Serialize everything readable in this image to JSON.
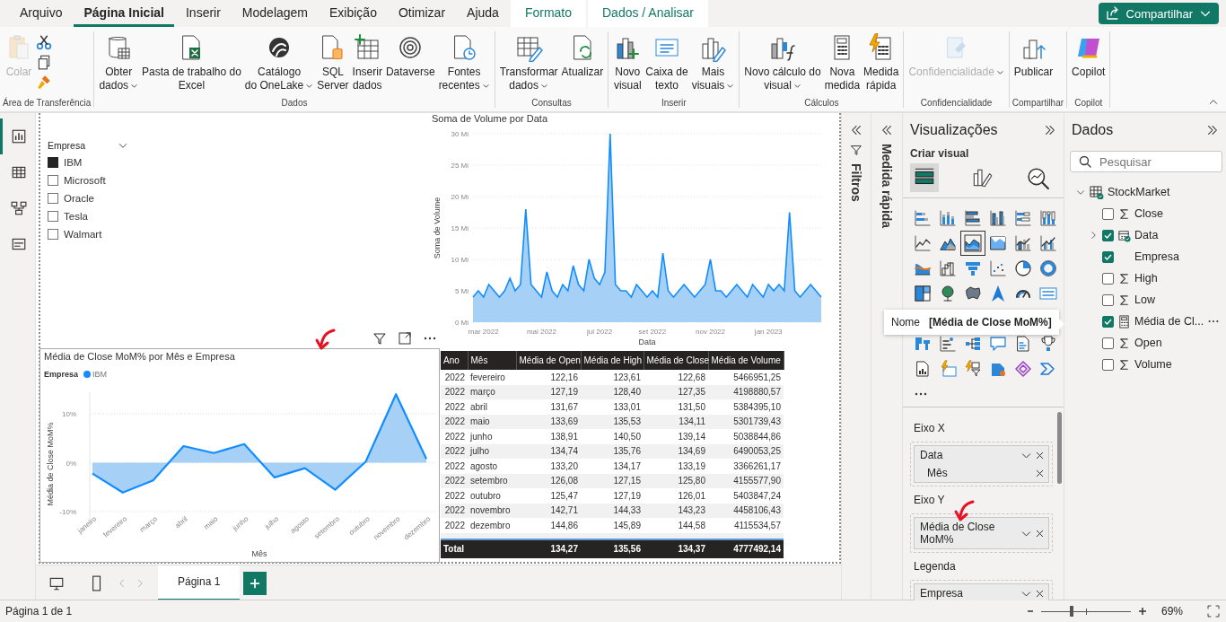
{
  "menu_tabs": [
    {
      "label": "Arquivo",
      "selected": false,
      "kind": "normal"
    },
    {
      "label": "Página Inicial",
      "selected": true,
      "kind": "normal"
    },
    {
      "label": "Inserir",
      "selected": false,
      "kind": "normal"
    },
    {
      "label": "Modelagem",
      "selected": false,
      "kind": "normal"
    },
    {
      "label": "Exibição",
      "selected": false,
      "kind": "normal"
    },
    {
      "label": "Otimizar",
      "selected": false,
      "kind": "normal"
    },
    {
      "label": "Ajuda",
      "selected": false,
      "kind": "normal"
    },
    {
      "label": "Formato",
      "selected": false,
      "kind": "contextual"
    },
    {
      "label": "Dados / Analisar",
      "selected": false,
      "kind": "contextual"
    }
  ],
  "share_button": {
    "label": "Compartilhar"
  },
  "ribbon_groups": [
    {
      "label": "Área de Transferência",
      "buttons": [
        {
          "kind": "paste",
          "lines": [
            "Colar"
          ],
          "disabled": true,
          "dropdown": false
        }
      ],
      "small_buttons": [
        {
          "kind": "cut"
        },
        {
          "kind": "copy"
        },
        {
          "kind": "painter"
        }
      ]
    },
    {
      "label": "Dados",
      "buttons": [
        {
          "kind": "database",
          "lines": [
            "Obter",
            "dados"
          ],
          "disabled": false,
          "dropdown": true
        },
        {
          "kind": "excel",
          "lines": [
            "Pasta de trabalho do",
            "Excel"
          ],
          "disabled": false,
          "dropdown": false
        },
        {
          "kind": "onelake",
          "lines": [
            "Catálogo",
            "do OneLake"
          ],
          "disabled": false,
          "dropdown": true
        },
        {
          "kind": "sql",
          "lines": [
            "SQL",
            "Server"
          ],
          "disabled": false,
          "dropdown": false
        },
        {
          "kind": "insert-table",
          "lines": [
            "Inserir",
            "dados"
          ],
          "disabled": false,
          "dropdown": false
        },
        {
          "kind": "dataverse",
          "lines": [
            "Dataverse"
          ],
          "disabled": false,
          "dropdown": false
        },
        {
          "kind": "recent",
          "lines": [
            "Fontes",
            "recentes"
          ],
          "disabled": false,
          "dropdown": true
        }
      ]
    },
    {
      "label": "Consultas",
      "buttons": [
        {
          "kind": "transform",
          "lines": [
            "Transformar",
            "dados"
          ],
          "disabled": false,
          "dropdown": true
        },
        {
          "kind": "refresh",
          "lines": [
            "Atualizar"
          ],
          "disabled": false,
          "dropdown": false
        }
      ]
    },
    {
      "label": "Inserir",
      "buttons": [
        {
          "kind": "new-visual",
          "lines": [
            "Novo",
            "visual"
          ],
          "disabled": false,
          "dropdown": false
        },
        {
          "kind": "textbox",
          "lines": [
            "Caixa de",
            "texto"
          ],
          "disabled": false,
          "dropdown": false
        },
        {
          "kind": "more-visuals",
          "lines": [
            "Mais",
            "visuais"
          ],
          "disabled": false,
          "dropdown": true
        }
      ]
    },
    {
      "label": "Cálculos",
      "buttons": [
        {
          "kind": "calc",
          "lines": [
            "Novo cálculo do",
            "visual"
          ],
          "disabled": false,
          "dropdown": true
        },
        {
          "kind": "measure",
          "lines": [
            "Nova",
            "medida"
          ],
          "disabled": false,
          "dropdown": false
        },
        {
          "kind": "quick",
          "lines": [
            "Medida",
            "rápida"
          ],
          "disabled": false,
          "dropdown": false
        }
      ]
    },
    {
      "label": "Confidencialidade",
      "buttons": [
        {
          "kind": "sensitivity",
          "lines": [
            "Confidencialidade"
          ],
          "disabled": true,
          "dropdown": true
        }
      ]
    },
    {
      "label": "Compartilhar",
      "buttons": [
        {
          "kind": "publish",
          "lines": [
            "Publicar"
          ],
          "disabled": false,
          "dropdown": false
        }
      ]
    },
    {
      "label": "Copilot",
      "buttons": [
        {
          "kind": "copilot",
          "lines": [
            "Copilot"
          ],
          "disabled": false,
          "dropdown": false
        }
      ]
    }
  ],
  "views": [
    {
      "kind": "report",
      "selected": true
    },
    {
      "kind": "table",
      "selected": false
    },
    {
      "kind": "model",
      "selected": false
    },
    {
      "kind": "dax",
      "selected": false
    }
  ],
  "slicer": {
    "title": "Empresa",
    "items": [
      {
        "label": "IBM",
        "selected": true
      },
      {
        "label": "Microsoft",
        "selected": false
      },
      {
        "label": "Oracle",
        "selected": false
      },
      {
        "label": "Tesla",
        "selected": false
      },
      {
        "label": "Walmart",
        "selected": false
      }
    ]
  },
  "volume_chart": {
    "chart_data": {
      "type": "area",
      "title": "Soma de Volume por Data",
      "xlabel": "Data",
      "ylabel": "Soma de Volume",
      "grid": true,
      "ylim": [
        0,
        30
      ],
      "categories": [
        null,
        null,
        "mar 2022",
        null,
        null,
        null,
        null,
        null,
        null,
        null,
        null,
        null,
        null,
        "mai 2022",
        null,
        null,
        null,
        null,
        null,
        null,
        null,
        null,
        null,
        null,
        "jul 2022",
        null,
        null,
        null,
        null,
        null,
        null,
        null,
        null,
        null,
        "set 2022",
        null,
        null,
        null,
        null,
        null,
        null,
        null,
        null,
        null,
        null,
        "nov 2022",
        null,
        null,
        null,
        null,
        null,
        null,
        null,
        null,
        null,
        null,
        "jan 2023",
        null,
        null,
        null,
        null,
        null,
        null,
        null,
        null,
        null,
        null
      ],
      "values": [
        4,
        5,
        4,
        6,
        5,
        4,
        5,
        7,
        5,
        6,
        18,
        6,
        5,
        4,
        8,
        5,
        4,
        6,
        5,
        9,
        6,
        5,
        10,
        7,
        6,
        8,
        30,
        6,
        5,
        5,
        4,
        6,
        5,
        4,
        5,
        4,
        11,
        5,
        4,
        5,
        6,
        5,
        4,
        5,
        6,
        10,
        5,
        5,
        4,
        5,
        6,
        5,
        4,
        6,
        5,
        4,
        6,
        5,
        6,
        5,
        17.5,
        5,
        4,
        5,
        6,
        5,
        4
      ],
      "yticks": [
        {
          "value": 0,
          "label": "0 Mi"
        },
        {
          "value": 5,
          "label": "5 Mi"
        },
        {
          "value": 10,
          "label": "10 Mi"
        },
        {
          "value": 15,
          "label": "15 Mi"
        },
        {
          "value": 20,
          "label": "20 Mi"
        },
        {
          "value": 25,
          "label": "25 Mi"
        },
        {
          "value": 30,
          "label": "30 Mi"
        }
      ]
    }
  },
  "mom_chart": {
    "selected": true,
    "legend_title": "Empresa",
    "chart_data": {
      "type": "area",
      "title": "Média de Close MoM% por Mês e Empresa",
      "xlabel": "Mês",
      "ylabel": "Média de Close MoM%",
      "grid": true,
      "ylim": [
        -12,
        14.5
      ],
      "categories": [
        "janeiro",
        "fevereiro",
        "março",
        "abril",
        "maio",
        "junho",
        "julho",
        "agosto",
        "setembro",
        "outubro",
        "novembro",
        "dezembro"
      ],
      "series": [
        {
          "name": "IBM",
          "color": "#118dff",
          "values": [
            -2.2,
            -6.1,
            -3.6,
            3.4,
            2.0,
            3.8,
            -3.0,
            -1.1,
            -5.5,
            0.2,
            14.0,
            0.8
          ]
        }
      ],
      "yticks": [
        {
          "value": -10,
          "label": "-10%"
        },
        {
          "value": 0,
          "label": "0%"
        },
        {
          "value": 10,
          "label": "10%"
        }
      ]
    }
  },
  "table": {
    "columns": [
      "Ano",
      "Mês",
      "Média de Open",
      "Média de High",
      "Média de Close",
      "Média de Volume"
    ],
    "rows": [
      [
        "2022",
        "fevereiro",
        "122,16",
        "123,61",
        "122,68",
        "5466951,25"
      ],
      [
        "2022",
        "março",
        "127,19",
        "128,40",
        "127,35",
        "4198880,57"
      ],
      [
        "2022",
        "abril",
        "131,67",
        "133,01",
        "131,50",
        "5384395,10"
      ],
      [
        "2022",
        "maio",
        "133,69",
        "135,53",
        "134,11",
        "5301739,43"
      ],
      [
        "2022",
        "junho",
        "138,91",
        "140,50",
        "139,14",
        "5038844,86"
      ],
      [
        "2022",
        "julho",
        "134,74",
        "135,76",
        "134,69",
        "6490053,25"
      ],
      [
        "2022",
        "agosto",
        "133,20",
        "134,17",
        "133,19",
        "3366261,17"
      ],
      [
        "2022",
        "setembro",
        "126,08",
        "127,15",
        "125,80",
        "4155577,90"
      ],
      [
        "2022",
        "outubro",
        "125,47",
        "127,19",
        "126,01",
        "5403847,24"
      ],
      [
        "2022",
        "novembro",
        "142,71",
        "144,33",
        "143,23",
        "4458106,43"
      ],
      [
        "2022",
        "dezembro",
        "144,86",
        "145,89",
        "144,58",
        "4115534,57"
      ]
    ],
    "total": {
      "label": "Total",
      "values": [
        "134,27",
        "135,56",
        "134,37",
        "4777492,14"
      ]
    }
  },
  "page_tabs": [
    {
      "label": "Página 1",
      "selected": true
    }
  ],
  "filters_pane": {
    "label": "Filtros"
  },
  "quick_measure_pane": {
    "label": "Medida rápida"
  },
  "visualizations": {
    "title": "Visualizações",
    "subtitle": "Criar visual",
    "modes": [
      {
        "kind": "build",
        "selected": true
      },
      {
        "kind": "format",
        "selected": false
      },
      {
        "kind": "analytics",
        "selected": false
      }
    ],
    "gallery": [
      {
        "kind": "stacked-bar",
        "selected": false
      },
      {
        "kind": "stacked-column",
        "selected": false
      },
      {
        "kind": "clustered-bar",
        "selected": false
      },
      {
        "kind": "clustered-column",
        "selected": false
      },
      {
        "kind": "full-bar",
        "selected": false
      },
      {
        "kind": "full-column",
        "selected": false
      },
      {
        "kind": "line",
        "selected": false
      },
      {
        "kind": "area",
        "selected": false
      },
      {
        "kind": "stacked-area",
        "selected": true
      },
      {
        "kind": "full-area",
        "selected": false
      },
      {
        "kind": "line-column",
        "selected": false
      },
      {
        "kind": "line-clustered",
        "selected": false
      },
      {
        "kind": "ribbon",
        "selected": false
      },
      {
        "kind": "waterfall",
        "selected": false
      },
      {
        "kind": "funnel",
        "selected": false
      },
      {
        "kind": "scatter",
        "selected": false
      },
      {
        "kind": "pie",
        "selected": false
      },
      {
        "kind": "donut",
        "selected": false
      },
      {
        "kind": "treemap",
        "selected": false
      },
      {
        "kind": "globe",
        "selected": false
      },
      {
        "kind": "filled-map",
        "selected": false
      },
      {
        "kind": "navigation",
        "selected": false
      },
      {
        "kind": "gauge",
        "selected": false
      },
      {
        "kind": "card",
        "selected": false
      },
      {
        "kind": "python",
        "selected": false
      },
      {
        "kind": "key-influencers",
        "selected": false
      },
      {
        "kind": "decomposition",
        "selected": false
      },
      {
        "kind": "qna",
        "selected": false
      },
      {
        "kind": "narrative",
        "selected": false
      },
      {
        "kind": "kpi",
        "selected": false
      },
      {
        "kind": "paginated",
        "selected": false
      },
      {
        "kind": "card-new",
        "selected": false
      },
      {
        "kind": "slicer-new",
        "selected": false
      },
      {
        "kind": "apps",
        "selected": false
      },
      {
        "kind": "diamond",
        "selected": false
      },
      {
        "kind": "flow",
        "selected": false
      }
    ],
    "wells": [
      {
        "label": "Eixo X",
        "fields": [
          {
            "label": "Data",
            "kind": "field",
            "dropdown": true
          },
          {
            "label": "Mês",
            "kind": "level",
            "dropdown": false
          }
        ]
      },
      {
        "label": "Eixo Y",
        "fields": [
          {
            "label": "Média de Close MoM%",
            "kind": "field",
            "dropdown": true
          }
        ]
      },
      {
        "label": "Legenda",
        "fields": [
          {
            "label": "Empresa",
            "kind": "field",
            "dropdown": true
          }
        ]
      }
    ]
  },
  "tooltip": {
    "key": "Nome",
    "value": "[Média de Close MoM%]"
  },
  "data_pane": {
    "title": "Dados",
    "search": {
      "placeholder": "Pesquisar"
    },
    "tree": [
      {
        "label": "StockMarket",
        "kind": "table",
        "expanded": true,
        "children": [
          {
            "label": "Close",
            "kind": "sum",
            "checked": false
          },
          {
            "label": "Data",
            "kind": "date",
            "checked": true,
            "expanded": false
          },
          {
            "label": "Empresa",
            "kind": "text",
            "checked": true
          },
          {
            "label": "High",
            "kind": "sum",
            "checked": false
          },
          {
            "label": "Low",
            "kind": "sum",
            "checked": false
          },
          {
            "label": "Média de Cl...",
            "kind": "measure",
            "checked": true
          },
          {
            "label": "Open",
            "kind": "sum",
            "checked": false
          },
          {
            "label": "Volume",
            "kind": "sum",
            "checked": false
          }
        ]
      }
    ]
  },
  "status_bar": {
    "page_info": "Página 1 de 1",
    "zoom": {
      "level": 0.34,
      "reading": "69%"
    }
  }
}
